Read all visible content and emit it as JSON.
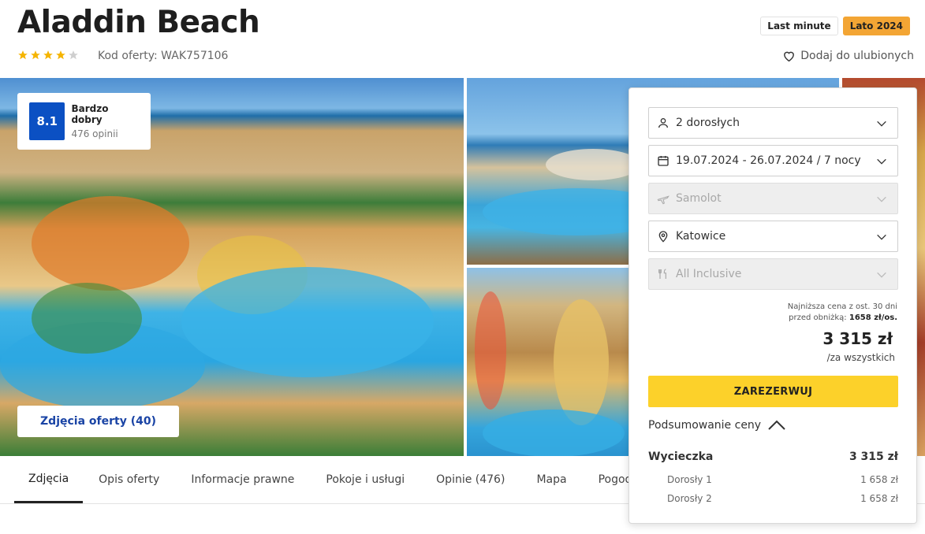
{
  "hotel": {
    "name": "Aladdin Beach",
    "stars": 4,
    "code": "Kod oferty: WAK757106"
  },
  "badges": {
    "last_minute": "Last minute",
    "season": "Lato 2024"
  },
  "favorite": {
    "label": "Dodaj do ulubionych"
  },
  "rating": {
    "score": "8.1",
    "label": "Bardzo dobry",
    "count": "476 opinii"
  },
  "photos_button": "Zdjęcia oferty (40)",
  "tabs": [
    {
      "label": "Zdjęcia"
    },
    {
      "label": "Opis oferty"
    },
    {
      "label": "Informacje prawne"
    },
    {
      "label": "Pokoje i usługi"
    },
    {
      "label": "Opinie (476)"
    },
    {
      "label": "Mapa"
    },
    {
      "label": "Pogoda"
    }
  ],
  "booking": {
    "travelers": "2 dorosłych",
    "dates": "19.07.2024 - 26.07.2024 / 7 nocy",
    "transport": "Samolot",
    "departure": "Katowice",
    "board": "All Inclusive",
    "lowest_price_line1": "Najniższa cena z ost. 30 dni",
    "lowest_price_line2": "przed obniżką:",
    "lowest_price_value": "1658 zł/os.",
    "price": "3 315 zł",
    "price_per": "/za wszystkich",
    "book_label": "ZAREZERWUJ",
    "summary_label": "Podsumowanie ceny",
    "trip_label": "Wycieczka",
    "trip_price": "3 315 zł",
    "adults": [
      {
        "label": "Dorosły 1",
        "price": "1 658 zł"
      },
      {
        "label": "Dorosły 2",
        "price": "1 658 zł"
      }
    ]
  },
  "colors": {
    "accent_blue": "#0b50c3",
    "book_yellow": "#fcd12a",
    "season_orange": "#f3a534",
    "star_gold": "#f5b400"
  }
}
